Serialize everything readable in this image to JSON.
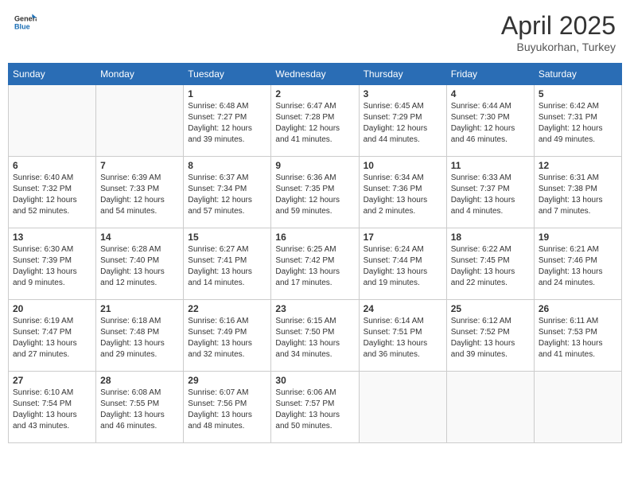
{
  "header": {
    "logo_general": "General",
    "logo_blue": "Blue",
    "month_title": "April 2025",
    "location": "Buyukorhan, Turkey"
  },
  "days_of_week": [
    "Sunday",
    "Monday",
    "Tuesday",
    "Wednesday",
    "Thursday",
    "Friday",
    "Saturday"
  ],
  "weeks": [
    [
      {
        "day": "",
        "detail": ""
      },
      {
        "day": "",
        "detail": ""
      },
      {
        "day": "1",
        "detail": "Sunrise: 6:48 AM\nSunset: 7:27 PM\nDaylight: 12 hours and 39 minutes."
      },
      {
        "day": "2",
        "detail": "Sunrise: 6:47 AM\nSunset: 7:28 PM\nDaylight: 12 hours and 41 minutes."
      },
      {
        "day": "3",
        "detail": "Sunrise: 6:45 AM\nSunset: 7:29 PM\nDaylight: 12 hours and 44 minutes."
      },
      {
        "day": "4",
        "detail": "Sunrise: 6:44 AM\nSunset: 7:30 PM\nDaylight: 12 hours and 46 minutes."
      },
      {
        "day": "5",
        "detail": "Sunrise: 6:42 AM\nSunset: 7:31 PM\nDaylight: 12 hours and 49 minutes."
      }
    ],
    [
      {
        "day": "6",
        "detail": "Sunrise: 6:40 AM\nSunset: 7:32 PM\nDaylight: 12 hours and 52 minutes."
      },
      {
        "day": "7",
        "detail": "Sunrise: 6:39 AM\nSunset: 7:33 PM\nDaylight: 12 hours and 54 minutes."
      },
      {
        "day": "8",
        "detail": "Sunrise: 6:37 AM\nSunset: 7:34 PM\nDaylight: 12 hours and 57 minutes."
      },
      {
        "day": "9",
        "detail": "Sunrise: 6:36 AM\nSunset: 7:35 PM\nDaylight: 12 hours and 59 minutes."
      },
      {
        "day": "10",
        "detail": "Sunrise: 6:34 AM\nSunset: 7:36 PM\nDaylight: 13 hours and 2 minutes."
      },
      {
        "day": "11",
        "detail": "Sunrise: 6:33 AM\nSunset: 7:37 PM\nDaylight: 13 hours and 4 minutes."
      },
      {
        "day": "12",
        "detail": "Sunrise: 6:31 AM\nSunset: 7:38 PM\nDaylight: 13 hours and 7 minutes."
      }
    ],
    [
      {
        "day": "13",
        "detail": "Sunrise: 6:30 AM\nSunset: 7:39 PM\nDaylight: 13 hours and 9 minutes."
      },
      {
        "day": "14",
        "detail": "Sunrise: 6:28 AM\nSunset: 7:40 PM\nDaylight: 13 hours and 12 minutes."
      },
      {
        "day": "15",
        "detail": "Sunrise: 6:27 AM\nSunset: 7:41 PM\nDaylight: 13 hours and 14 minutes."
      },
      {
        "day": "16",
        "detail": "Sunrise: 6:25 AM\nSunset: 7:42 PM\nDaylight: 13 hours and 17 minutes."
      },
      {
        "day": "17",
        "detail": "Sunrise: 6:24 AM\nSunset: 7:44 PM\nDaylight: 13 hours and 19 minutes."
      },
      {
        "day": "18",
        "detail": "Sunrise: 6:22 AM\nSunset: 7:45 PM\nDaylight: 13 hours and 22 minutes."
      },
      {
        "day": "19",
        "detail": "Sunrise: 6:21 AM\nSunset: 7:46 PM\nDaylight: 13 hours and 24 minutes."
      }
    ],
    [
      {
        "day": "20",
        "detail": "Sunrise: 6:19 AM\nSunset: 7:47 PM\nDaylight: 13 hours and 27 minutes."
      },
      {
        "day": "21",
        "detail": "Sunrise: 6:18 AM\nSunset: 7:48 PM\nDaylight: 13 hours and 29 minutes."
      },
      {
        "day": "22",
        "detail": "Sunrise: 6:16 AM\nSunset: 7:49 PM\nDaylight: 13 hours and 32 minutes."
      },
      {
        "day": "23",
        "detail": "Sunrise: 6:15 AM\nSunset: 7:50 PM\nDaylight: 13 hours and 34 minutes."
      },
      {
        "day": "24",
        "detail": "Sunrise: 6:14 AM\nSunset: 7:51 PM\nDaylight: 13 hours and 36 minutes."
      },
      {
        "day": "25",
        "detail": "Sunrise: 6:12 AM\nSunset: 7:52 PM\nDaylight: 13 hours and 39 minutes."
      },
      {
        "day": "26",
        "detail": "Sunrise: 6:11 AM\nSunset: 7:53 PM\nDaylight: 13 hours and 41 minutes."
      }
    ],
    [
      {
        "day": "27",
        "detail": "Sunrise: 6:10 AM\nSunset: 7:54 PM\nDaylight: 13 hours and 43 minutes."
      },
      {
        "day": "28",
        "detail": "Sunrise: 6:08 AM\nSunset: 7:55 PM\nDaylight: 13 hours and 46 minutes."
      },
      {
        "day": "29",
        "detail": "Sunrise: 6:07 AM\nSunset: 7:56 PM\nDaylight: 13 hours and 48 minutes."
      },
      {
        "day": "30",
        "detail": "Sunrise: 6:06 AM\nSunset: 7:57 PM\nDaylight: 13 hours and 50 minutes."
      },
      {
        "day": "",
        "detail": ""
      },
      {
        "day": "",
        "detail": ""
      },
      {
        "day": "",
        "detail": ""
      }
    ]
  ]
}
